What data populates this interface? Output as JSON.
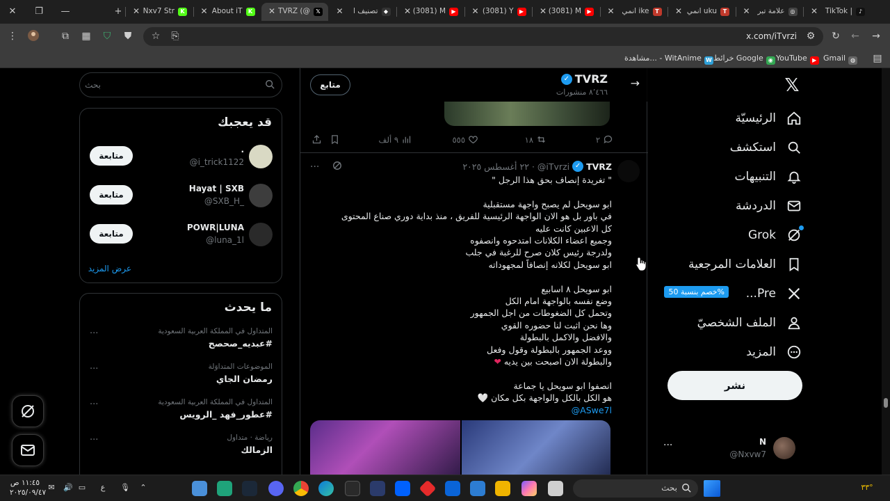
{
  "browser": {
    "tabs": [
      {
        "title": "TikTok |",
        "favicon": "tiktok-icon",
        "color": "#111111",
        "glyph": "♪"
      },
      {
        "title": "علامة تبر",
        "favicon": "openai-icon",
        "color": "#444444",
        "glyph": "◎"
      },
      {
        "title": "انمي uku",
        "favicon": "top-icon",
        "color": "#c0392b",
        "glyph": "T"
      },
      {
        "title": "انمي ike",
        "favicon": "top-icon",
        "color": "#c0392b",
        "glyph": "T"
      },
      {
        "title": "(3081) M",
        "favicon": "youtube-icon",
        "color": "#ff0000",
        "glyph": "▶"
      },
      {
        "title": "(3081) Y",
        "favicon": "youtube-icon",
        "color": "#ff0000",
        "glyph": "▶"
      },
      {
        "title": "(3081) M",
        "favicon": "youtube-icon",
        "color": "#ff0000",
        "glyph": "▶"
      },
      {
        "title": "تصنيف ا",
        "favicon": "diamond-icon",
        "color": "#333333",
        "glyph": "◆"
      },
      {
        "title": "TVRZ (@",
        "favicon": "x-icon",
        "color": "#000000",
        "glyph": "𝕏",
        "active": true
      },
      {
        "title": "About iT",
        "favicon": "kick-icon",
        "color": "#53fc18",
        "glyph": "K"
      },
      {
        "title": "Nxv7 Str",
        "favicon": "kick-icon",
        "color": "#53fc18",
        "glyph": "K"
      }
    ],
    "url": "x.com/iTvrzi",
    "bookmarks": [
      {
        "label": "Gmail",
        "icon": "globe-icon",
        "color": "#666666",
        "glyph": "◍"
      },
      {
        "label": "YouTube",
        "icon": "youtube-icon",
        "color": "#ff0000",
        "glyph": "▶"
      },
      {
        "label": "خرائط Google",
        "icon": "maps-icon",
        "color": "#34a853",
        "glyph": "◉"
      },
      {
        "label": "مشاهدة... - WitAnime",
        "icon": "witanime-icon",
        "color": "#2ea0d8",
        "glyph": "W"
      }
    ]
  },
  "nav": {
    "items": [
      {
        "label": "الرئيسيّة",
        "icon": "home-icon"
      },
      {
        "label": "استكشف",
        "icon": "search-icon"
      },
      {
        "label": "التنبيهات",
        "icon": "bell-icon"
      },
      {
        "label": "الدردشة",
        "icon": "mail-icon"
      },
      {
        "label": "Grok",
        "icon": "grok-icon"
      },
      {
        "label": "العلامات المرجعية",
        "icon": "bookmark-icon"
      },
      {
        "label": "Pre...",
        "icon": "x-premium-icon"
      },
      {
        "label": "الملف الشخصيّ",
        "icon": "person-icon"
      },
      {
        "label": "المزيد",
        "icon": "more-circle-icon"
      }
    ],
    "premium_badge": "%خصم بنسبة 50",
    "post_button": "نشر",
    "account": {
      "name": "N",
      "handle": "@Nxvw7",
      "more": "···"
    }
  },
  "profile_header": {
    "name": "TVRZ",
    "post_count": "٨٬٤٦٦ منشورات",
    "follow_button": "متابع"
  },
  "prev_tweet_actions": {
    "replies": "٢",
    "reposts": "١٨",
    "likes": "٥٥٥",
    "views": "٩ ألف"
  },
  "tweet": {
    "author": "TVRZ",
    "handle": "@iTvrzi",
    "separator": "·",
    "date": "٢٢ أغسطس ٢٠٢٥",
    "more": "···",
    "body": "\" تغريدة إنصاف بحق هذا الرجل \"\n\nابو سويحل لم يصبح واجهة مستقبلية\nفي باور بل هو الان الواجهة الرئيسية للفريق ، منذ بداية دوري صناع المحتوى\nكل الاعبين كانت عليه\nوجميع اعضاء الكلانات امتدحوه وانصفوه\nولدرجة رئيس كلان صرح للرغبة في جلب\nابو سويحل لكلانه إنصافاً لمجهوداته\n\nابو سويحل ٨ اسابيع\nوضع نفسه بالواجهة امام الكل\nوتحمل كل الضغوطات من اجل الجمهور\nوها نحن اثبت لنا حضوره القوي\nوالافضل والاكمل بالبطولة\nووعد الجمهور بالبطولة وقول وفعل\nوالبطولة الان اصبحت بين يديه",
    "body_heart": "❤",
    "body2": "انصفوا ابو سويحل يا جماعة\nهو الكل بالكل والواجهة بكل مكان",
    "body2_heart": "🤍",
    "mention": "@ASwe7l"
  },
  "sidebar": {
    "search_placeholder": "بحث",
    "who_to_follow": {
      "title": "قد يعجبك",
      "users": [
        {
          "name": ".",
          "handle": "@i_trick1122",
          "button": "متابعة",
          "color": "#d9d9c4"
        },
        {
          "name": "Hayat | SXB",
          "handle": "@SXB_H_",
          "button": "متابعة",
          "color": "#3d3d3d"
        },
        {
          "name": "POWR|LUNA",
          "handle": "@luna_1l",
          "button": "متابعة",
          "color": "#2a2a2a"
        }
      ],
      "show_more": "عرض المزيد"
    },
    "trends": {
      "title": "ما يحدث",
      "items": [
        {
          "context": "المتداول في المملكة العربية السعودية",
          "title": "#عبديه_صحصح"
        },
        {
          "context": "الموضوعات المتداوَلة",
          "title": "رمضان الجاي"
        },
        {
          "context": "المتداول في المملكة العربية السعودية",
          "title": "#عطور_فهد _الرويس"
        },
        {
          "context": "رياضة · متداول",
          "title": "الزمالك"
        }
      ]
    }
  },
  "taskbar": {
    "search_placeholder": "بحث",
    "time": "١١:٤٥ ص",
    "date": "٢٠٢٥/٠٩/٤٧",
    "lang": "ع",
    "temp": "٣٣°"
  }
}
